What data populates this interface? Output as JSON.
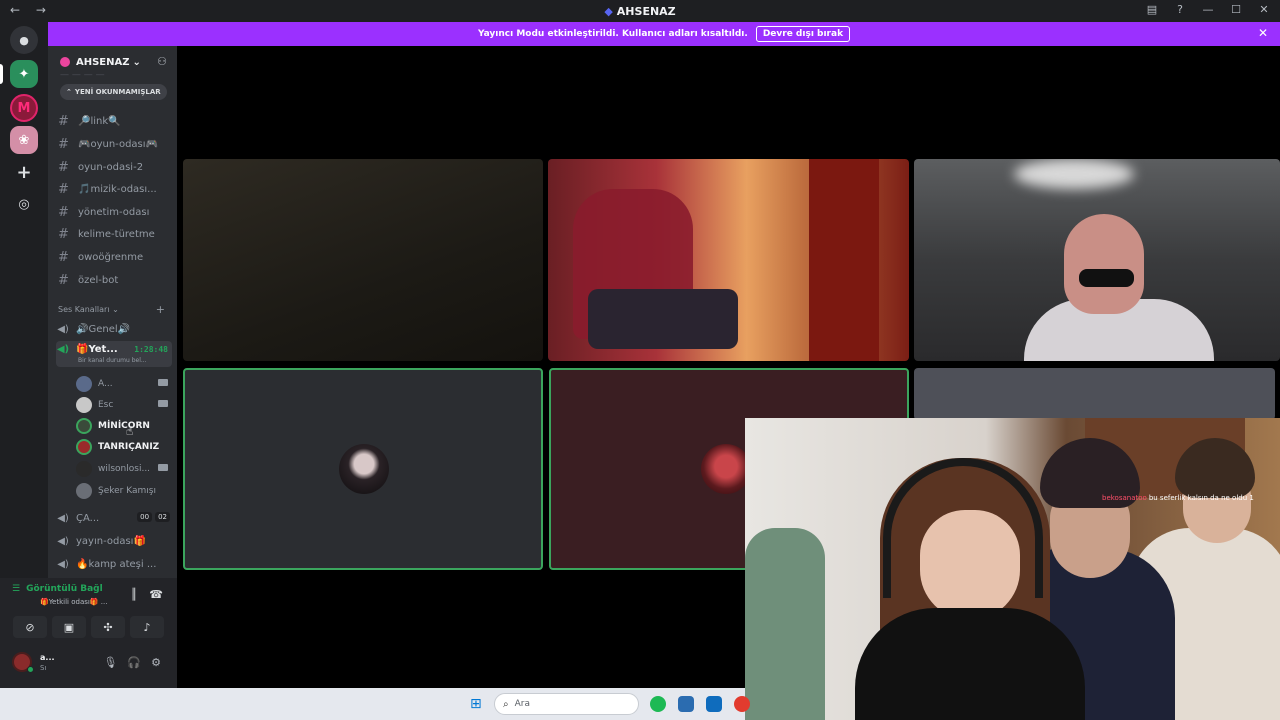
{
  "window": {
    "title": "AHSENAZ",
    "nav_back": "←",
    "nav_forward": "→"
  },
  "banner": {
    "text": "Yayıncı Modu etkinleştirildi. Kullanıcı adları kısaltıldı.",
    "button": "Devre dışı bırak"
  },
  "sidebar": {
    "guild_name": "AHSENAZ",
    "unread_label": "YENİ OKUNMAMIŞLAR",
    "text_channels": [
      "🔎link🔍",
      "🎮oyun-odası🎮",
      "oyun-odasi-2",
      "🎵mizik-odası...",
      "yönetim-odası",
      "kelime-türetme",
      "owoöğrenme",
      "özel-bot"
    ],
    "voice_category": "Ses Kanalları",
    "voice_channels": {
      "genel": "🔊Genel🔊",
      "active_name": "🎁Yet...",
      "active_timer": "1:28:48",
      "active_status": "Bir kanal durumu bel...",
      "ca_name": "ÇA...",
      "ca_count_a": "00",
      "ca_count_b": "02",
      "yayin": "yayın-odası🎁",
      "kamp": "🔥kamp ateşi ..."
    },
    "members": [
      "A...",
      "Esc",
      "MİNİCORN",
      "TANRIÇANIZ",
      "wilsonlosi...",
      "Şeker Kamışı"
    ]
  },
  "voice_panel": {
    "status": "Görüntülü Bağl",
    "channel": "🎁Yetkili odası🎁 ...",
    "user_name": "a...",
    "user_sub": "Sı"
  },
  "overlay": {
    "chat_nick": "bekosanatoo",
    "chat_text": "bu seferlik kalsın da ne oldu 1"
  },
  "taskbar": {
    "search_placeholder": "Ara"
  },
  "colors": {
    "accent": "#9b30ff",
    "speaking": "#3ba55d",
    "online": "#23a55a"
  }
}
